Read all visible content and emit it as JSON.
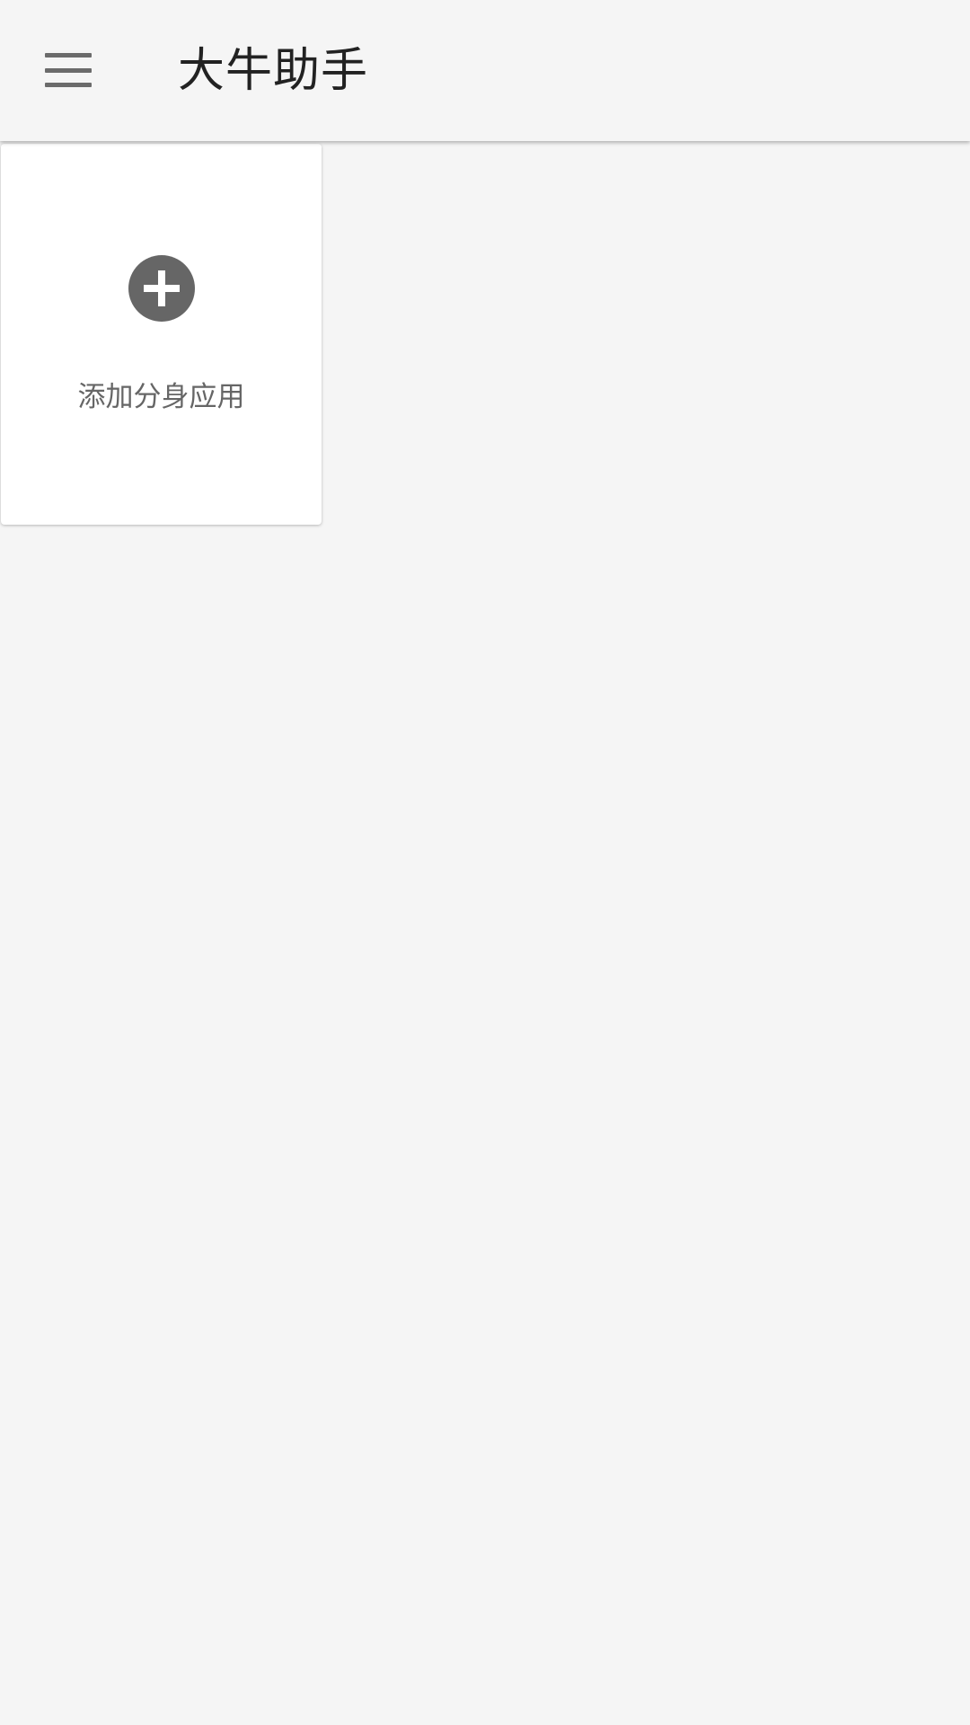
{
  "app_bar": {
    "title": "大牛助手",
    "menu_icon": "hamburger-menu-icon"
  },
  "main": {
    "add_card": {
      "label": "添加分身应用",
      "icon": "add-circle-icon"
    }
  },
  "colors": {
    "background": "#f5f5f5",
    "card": "#ffffff",
    "icon": "#666666",
    "title_text": "#222222",
    "label_text": "#666666"
  }
}
